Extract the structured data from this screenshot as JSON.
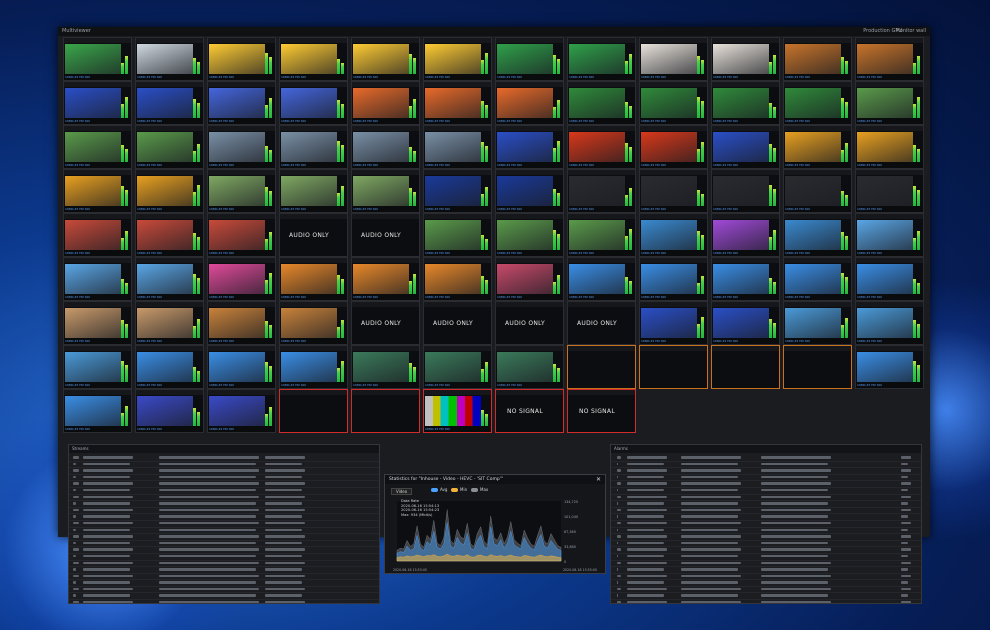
{
  "app": {
    "title": "Multiviewer",
    "right_label": "Production GPU",
    "right_label2": "Monitor wall"
  },
  "colors": {
    "accent": "#5aa0ff",
    "warn": "#c8721e",
    "error": "#d22b2b",
    "meter": "#48d04a"
  },
  "tiles": [
    [
      [
        "pitch",
        "",
        "#3aa64a"
      ],
      [
        "cricket",
        "",
        "#cfd8e0"
      ],
      [
        "pool-dive",
        "",
        "#ffcc33"
      ],
      [
        "pool-dive",
        "",
        "#ffcc33"
      ],
      [
        "pool-dive",
        "",
        "#ffcc33"
      ],
      [
        "pool-dive",
        "",
        "#ffcc33"
      ],
      [
        "stadium",
        "",
        "#2fa04a"
      ],
      [
        "stadium",
        "",
        "#2fa04a"
      ],
      [
        "kids",
        "",
        "#e8e2da"
      ],
      [
        "kids",
        "",
        "#e8e2da"
      ],
      [
        "lion",
        "",
        "#c8742a"
      ],
      [
        "lion",
        "",
        "#c8742a"
      ]
    ],
    [
      [
        "studio-blue",
        "",
        "#2a4fc8"
      ],
      [
        "studio-blue",
        "",
        "#2a4fc8"
      ],
      [
        "anchor",
        "",
        "#4466dd"
      ],
      [
        "anchor",
        "",
        "#4466dd"
      ],
      [
        "crowd-orange",
        "",
        "#e86a2a"
      ],
      [
        "crowd-orange",
        "",
        "#e86a2a"
      ],
      [
        "crowd-orange",
        "",
        "#e86a2a"
      ],
      [
        "horse-race",
        "",
        "#2f8a3a"
      ],
      [
        "horse-race",
        "",
        "#2f8a3a"
      ],
      [
        "horse-race",
        "",
        "#2f8a3a"
      ],
      [
        "horse-race",
        "",
        "#2f8a3a"
      ],
      [
        "golf",
        "",
        "#5a9a4a"
      ]
    ],
    [
      [
        "golf",
        "",
        "#5a9a4a"
      ],
      [
        "golf",
        "",
        "#5a9a4a"
      ],
      [
        "city",
        "",
        "#7a90a6"
      ],
      [
        "city",
        "",
        "#7a90a6"
      ],
      [
        "city",
        "",
        "#7a90a6"
      ],
      [
        "city",
        "",
        "#7a90a6"
      ],
      [
        "studio-blue",
        "",
        "#2a4fc8"
      ],
      [
        "sunset",
        "",
        "#d8381a"
      ],
      [
        "sunset",
        "",
        "#d8381a"
      ],
      [
        "studio-blue",
        "",
        "#2a4fc8"
      ],
      [
        "sunflower",
        "",
        "#e8a020"
      ],
      [
        "sunflower",
        "",
        "#e8a020"
      ]
    ],
    [
      [
        "sunflower",
        "",
        "#e8a020"
      ],
      [
        "sunflower",
        "",
        "#e8a020"
      ],
      [
        "cricket",
        "",
        "#7fa862"
      ],
      [
        "cricket",
        "",
        "#7fa862"
      ],
      [
        "cricket",
        "",
        "#7fa862"
      ],
      [
        "night-game",
        "",
        "#1a3a9a"
      ],
      [
        "night-game",
        "",
        "#1a3a9a"
      ],
      [
        "dark",
        "",
        "#2a2b2f"
      ],
      [
        "dark",
        "",
        "#2a2b2f"
      ],
      [
        "dark",
        "",
        "#2a2b2f"
      ],
      [
        "dark",
        "",
        "#2a2b2f"
      ],
      [
        "dark",
        "",
        "#2a2b2f"
      ]
    ],
    [
      [
        "dress",
        "",
        "#c84a3a"
      ],
      [
        "dress",
        "",
        "#c84a3a"
      ],
      [
        "dress",
        "",
        "#c84a3a"
      ],
      [
        "",
        "AUDIO ONLY",
        ""
      ],
      [
        "",
        "AUDIO ONLY",
        ""
      ],
      [
        "golf",
        "",
        "#5a9a4a"
      ],
      [
        "golf",
        "",
        "#5a9a4a"
      ],
      [
        "golf",
        "",
        "#5a9a4a"
      ],
      [
        "harbor",
        "",
        "#3a8ad0"
      ],
      [
        "concert",
        "",
        "#a04ad8"
      ],
      [
        "harbor",
        "",
        "#3a8ad0"
      ],
      [
        "boat",
        "",
        "#5aa6e6"
      ]
    ],
    [
      [
        "boat",
        "",
        "#5aa6e6"
      ],
      [
        "boat",
        "",
        "#5aa6e6"
      ],
      [
        "pink",
        "",
        "#e04a9a"
      ],
      [
        "fruit",
        "",
        "#e8882a"
      ],
      [
        "fruit",
        "",
        "#e8882a"
      ],
      [
        "fruit",
        "",
        "#e8882a"
      ],
      [
        "pink",
        "",
        "#c84a6a"
      ],
      [
        "sea",
        "",
        "#3a8ee6"
      ],
      [
        "sea",
        "",
        "#3a8ee6"
      ],
      [
        "sea",
        "",
        "#3a8ee6"
      ],
      [
        "sea",
        "",
        "#3a8ee6"
      ],
      [
        "sea",
        "",
        "#3a8ee6"
      ]
    ],
    [
      [
        "beach",
        "",
        "#c89a6a"
      ],
      [
        "beach",
        "",
        "#c89a6a"
      ],
      [
        "food",
        "",
        "#c8823a"
      ],
      [
        "food",
        "",
        "#c8823a"
      ],
      [
        "",
        "AUDIO ONLY",
        ""
      ],
      [
        "",
        "AUDIO ONLY",
        ""
      ],
      [
        "",
        "AUDIO ONLY",
        ""
      ],
      [
        "",
        "AUDIO ONLY",
        ""
      ],
      [
        "studio-blue",
        "",
        "#2a4fc8"
      ],
      [
        "studio-blue",
        "",
        "#2a4fc8"
      ],
      [
        "surf",
        "",
        "#4a9ad8"
      ],
      [
        "surf",
        "",
        "#4a9ad8"
      ]
    ],
    [
      [
        "surf",
        "",
        "#4a9ad8"
      ],
      [
        "coast",
        "",
        "#3a8ee6"
      ],
      [
        "coast",
        "",
        "#3a8ee6"
      ],
      [
        "coast",
        "",
        "#3a8ee6"
      ],
      [
        "waterfall",
        "",
        "#3a7a5a"
      ],
      [
        "waterfall",
        "",
        "#3a7a5a"
      ],
      [
        "waterfall",
        "",
        "#3a7a5a"
      ],
      [
        "",
        "",
        ""
      ],
      [
        "",
        "",
        ""
      ],
      [
        "",
        "",
        ""
      ],
      [
        "",
        "",
        ""
      ],
      [
        "kids-tv",
        "",
        "#3a8ee6"
      ]
    ],
    [
      [
        "kids-tv",
        "",
        "#3a8ee6"
      ],
      [
        "stage",
        "",
        "#3a4ac8"
      ],
      [
        "stage",
        "",
        "#3a4ac8"
      ],
      [
        "",
        "",
        ""
      ],
      [
        "",
        "",
        ""
      ],
      [
        "bars",
        "",
        ""
      ],
      [
        "",
        "NO SIGNAL",
        ""
      ],
      [
        "",
        "NO SIGNAL",
        ""
      ]
    ]
  ],
  "tile_states": [
    [
      7,
      7,
      "warn"
    ],
    [
      7,
      8,
      "warn"
    ],
    [
      7,
      9,
      "warn"
    ],
    [
      7,
      10,
      "warn"
    ],
    [
      8,
      3,
      "err"
    ],
    [
      8,
      4,
      "err"
    ],
    [
      8,
      5,
      "err"
    ],
    [
      8,
      6,
      "err"
    ],
    [
      8,
      7,
      "err"
    ]
  ],
  "tile_footer": "1080i 25  HD  SDI",
  "windows": {
    "left_title": "Streams",
    "right_title": "Alarms"
  },
  "stats": {
    "title": "Statistics for \"Inhouse - Video - HEVC - 'SIT Comp'\"",
    "filter": "Video",
    "legend": [
      "Avg",
      "Min",
      "Max"
    ],
    "info_lines": [
      "Data Rate",
      "2020-06-16 15:54:13",
      "2020-06-16 15:54:23",
      "Max: 934 (Mbit/s)"
    ],
    "y_ticks": [
      "134,720",
      "101,040",
      "67,360",
      "33,680",
      "0"
    ],
    "x_start": "2020-06-16 15:53:45",
    "x_end": "2020-06-16 15:55:00"
  },
  "chart_data": {
    "type": "area",
    "series": [
      {
        "name": "Avg",
        "values": [
          18,
          22,
          20,
          35,
          25,
          28,
          60,
          30,
          24,
          45,
          38,
          70,
          32,
          28,
          40,
          90,
          35,
          30,
          55,
          42,
          38,
          65,
          30,
          26,
          48,
          60,
          34,
          28,
          80,
          40,
          36,
          50,
          30,
          42,
          70,
          38,
          32,
          28,
          55,
          40,
          30,
          26,
          45,
          62,
          35,
          30,
          48,
          38,
          28,
          24
        ]
      },
      {
        "name": "Min",
        "values": [
          8,
          10,
          9,
          12,
          10,
          11,
          14,
          12,
          10,
          13,
          12,
          15,
          11,
          10,
          12,
          16,
          12,
          11,
          14,
          12,
          11,
          15,
          10,
          9,
          13,
          14,
          11,
          10,
          15,
          12,
          11,
          13,
          10,
          12,
          14,
          11,
          10,
          9,
          13,
          12,
          10,
          9,
          12,
          14,
          11,
          10,
          12,
          11,
          9,
          8
        ]
      },
      {
        "name": "Max",
        "values": [
          25,
          30,
          28,
          48,
          34,
          40,
          82,
          40,
          32,
          60,
          50,
          95,
          42,
          36,
          55,
          120,
          48,
          40,
          74,
          56,
          52,
          88,
          40,
          34,
          64,
          80,
          46,
          38,
          105,
          54,
          48,
          66,
          40,
          56,
          92,
          50,
          42,
          36,
          72,
          54,
          40,
          34,
          60,
          82,
          46,
          40,
          64,
          50,
          36,
          32
        ]
      }
    ],
    "ylim": [
      0,
      134720
    ]
  }
}
